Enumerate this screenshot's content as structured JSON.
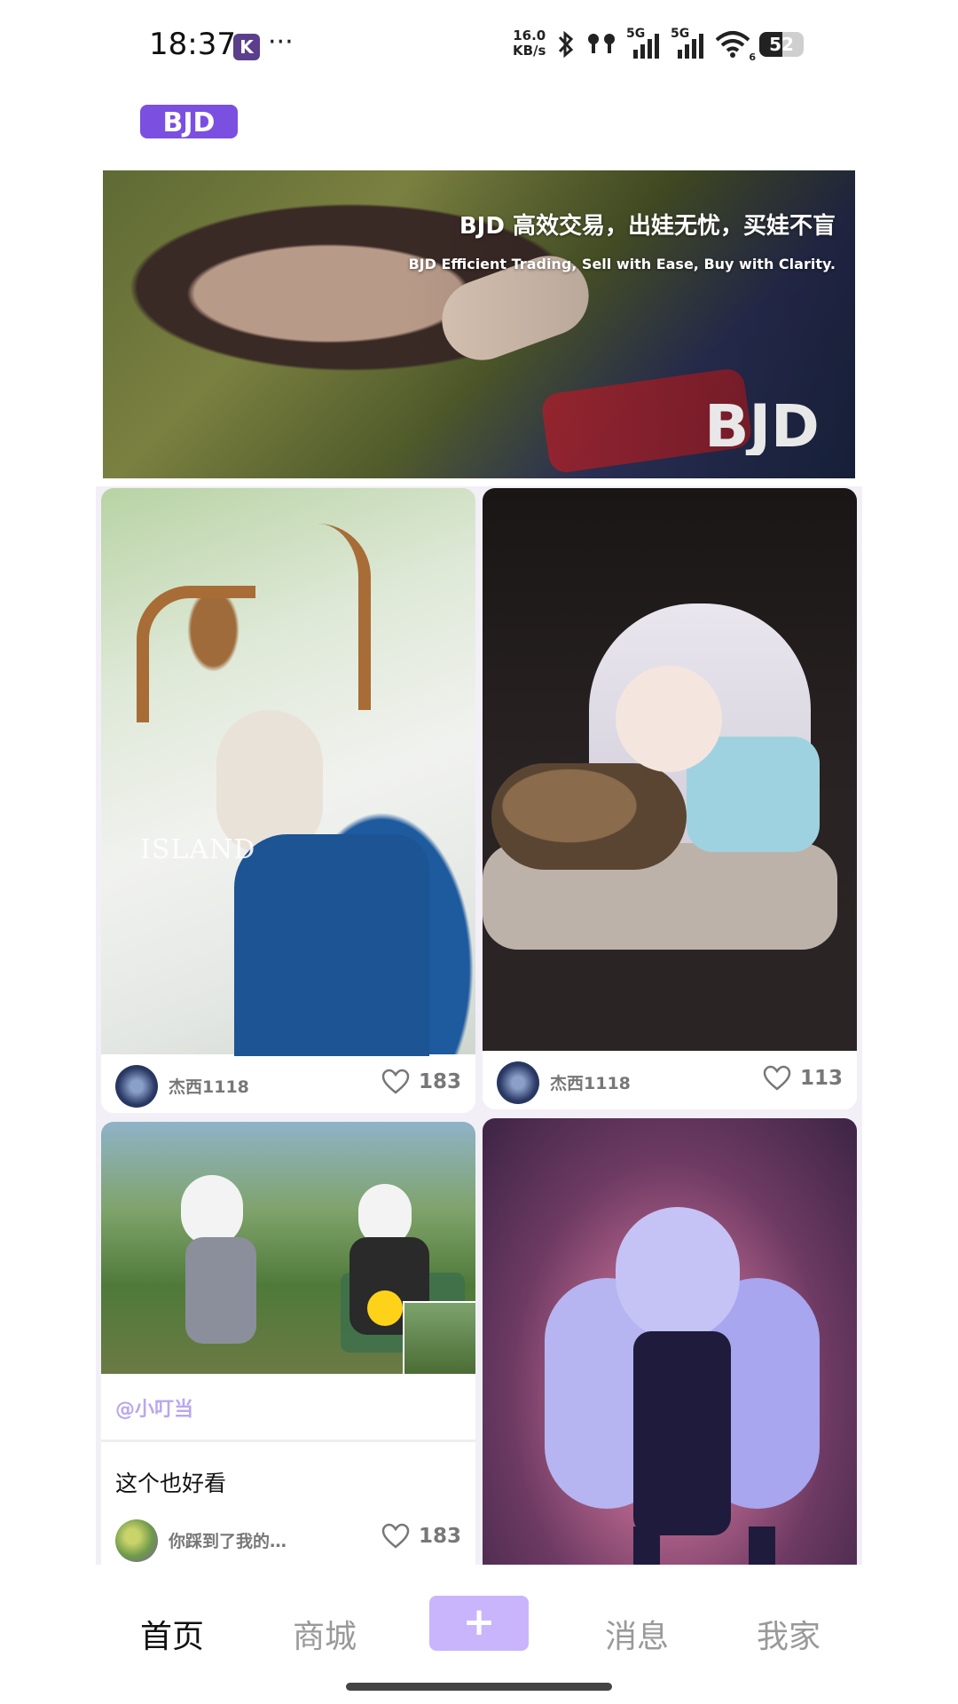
{
  "status_bar": {
    "time": "18:37",
    "app_badge": "K",
    "overflow": "···",
    "speed_value": "16.0",
    "speed_unit": "KB/s",
    "network_1": "5G",
    "network_2": "5G",
    "wifi_index": "6",
    "battery": "52",
    "battery_level": 0.52
  },
  "header": {
    "logo_text": "BJD"
  },
  "banner": {
    "title": "BJD 高效交易，出娃无忧，买娃不盲",
    "subtitle": "BJD Efficient Trading, Sell with Ease, Buy with Clarity.",
    "logo_text": "BJD"
  },
  "feed": {
    "cards": [
      {
        "image_brand": "ISLAND",
        "author": "杰西1118",
        "likes": "183"
      },
      {
        "author": "杰西1118",
        "likes": "113"
      },
      {
        "tag": "@小叮当",
        "caption": "这个也好看",
        "author": "你踩到了我的…",
        "likes": "183"
      },
      {}
    ]
  },
  "nav": {
    "home": "首页",
    "mall": "商城",
    "add": "+",
    "messages": "消息",
    "mine": "我家"
  },
  "colors": {
    "brand": "#7b4fe0",
    "accent_light": "#c9b5fb",
    "tag": "#b9a7ef",
    "muted": "#777777"
  }
}
